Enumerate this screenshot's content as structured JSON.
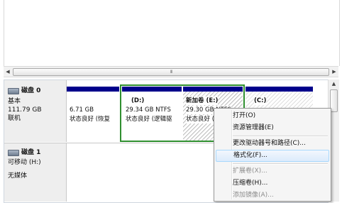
{
  "scrollbar": {
    "grip": "III"
  },
  "disk0": {
    "name": "磁盘 0",
    "type": "基本",
    "size": "111.79 GB",
    "status": "联机",
    "partitions": [
      {
        "title": "",
        "size": "6.71 GB",
        "status": "状态良好 (恢复"
      },
      {
        "title": "(D:)",
        "size": "29.34 GB NTFS",
        "status": "状态良好 (逻辑驱"
      },
      {
        "title": "新加卷 (E:)",
        "size": "29.30 GB NTFS",
        "status": "状态良好 (逻辑"
      },
      {
        "title": "(C:)",
        "size": "",
        "status": ""
      }
    ]
  },
  "disk1": {
    "name": "磁盘 1",
    "type": "可移动 (H:)",
    "status": "无媒体"
  },
  "context_menu": {
    "items": [
      {
        "label": "打开(O)",
        "enabled": true
      },
      {
        "label": "资源管理器(E)",
        "enabled": true
      },
      {
        "label": "更改驱动器号和路径(C)...",
        "enabled": true
      },
      {
        "label": "格式化(F)...",
        "enabled": true,
        "hover": true
      },
      {
        "label": "扩展卷(X)...",
        "enabled": false
      },
      {
        "label": "压缩卷(H)...",
        "enabled": true
      },
      {
        "label": "添加镜像(A)...",
        "enabled": false
      }
    ]
  },
  "colors": {
    "partition_bar": "#00008b",
    "selection_border": "#2f8f2f",
    "menu_hover": "#dcebfc"
  }
}
